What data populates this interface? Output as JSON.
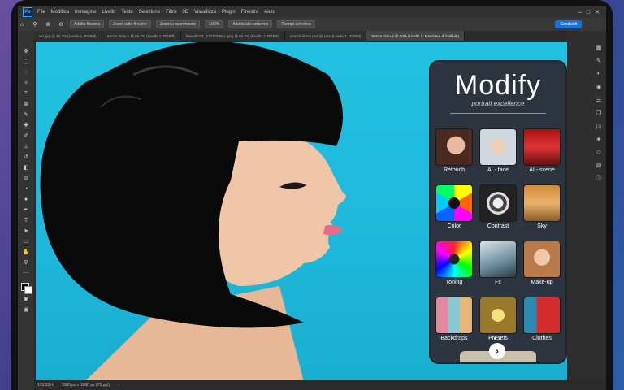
{
  "menubar": {
    "logo": "Ps",
    "items": [
      "File",
      "Modifica",
      "Immagine",
      "Livello",
      "Testo",
      "Selezione",
      "Filtro",
      "3D",
      "Visualizza",
      "Plugin",
      "Finestra",
      "Aiuto"
    ]
  },
  "optionsbar": {
    "buttons": [
      "Adatta finestra",
      "Zoom tutte finestre",
      "Zoom a scorrimento",
      "100%",
      "Adatta allo schermo",
      "Riempi schermo"
    ],
    "share_label": "Condividi"
  },
  "tabs": [
    "xxx.jpg @ 16,7% (Livello 1, RGB/8)",
    "Senza titolo-1 @ 66,7% (Livello 1, RGB/8)",
    "fotoedited1_21237399-1.jpeg @ 66,7% (Livello 1, RGB/8)",
    "search-direct.psd @ 15% (Livello 1, RGB/8)",
    "Senza titolo-2 @ 50% (Livello 1, Maschera di livello/8)"
  ],
  "active_tab_index": 4,
  "statusbar": {
    "zoom": "133,33%",
    "size": "1080 px x 1080 px (72 ppi)"
  },
  "plugin": {
    "title": "Modify",
    "subtitle": "portrait excellence",
    "tiles": [
      {
        "label": "Retouch",
        "icon": "retouch-thumb"
      },
      {
        "label": "AI - face",
        "icon": "ai-face-thumb"
      },
      {
        "label": "AI - scene",
        "icon": "ai-scene-thumb"
      },
      {
        "label": "Color",
        "icon": "color-thumb"
      },
      {
        "label": "Contrast",
        "icon": "contrast-thumb"
      },
      {
        "label": "Sky",
        "icon": "sky-thumb"
      },
      {
        "label": "Toning",
        "icon": "toning-thumb"
      },
      {
        "label": "Fx",
        "icon": "fx-thumb"
      },
      {
        "label": "Make-up",
        "icon": "makeup-thumb"
      },
      {
        "label": "Backdrops",
        "icon": "backdrops-thumb"
      },
      {
        "label": "Presets",
        "icon": "presets-thumb"
      },
      {
        "label": "Clothes",
        "icon": "clothes-thumb"
      }
    ],
    "next_glyph": "›",
    "page_count": 2,
    "current_page": 1
  },
  "colors": {
    "canvas_bg": "#22c0e0",
    "panel_bg": "#2c3440",
    "accent": "#1473e6"
  }
}
